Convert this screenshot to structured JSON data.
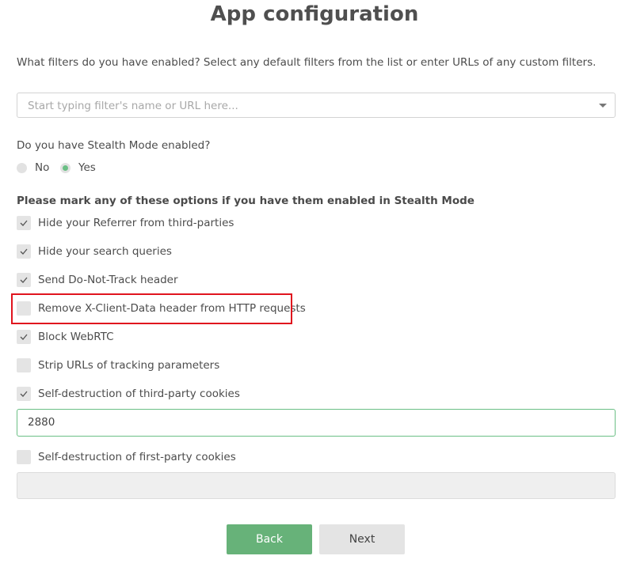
{
  "page": {
    "title": "App configuration",
    "intro": "What filters do you have enabled? Select any default filters from the list or enter URLs of any custom filters."
  },
  "filter_select": {
    "placeholder": "Start typing filter's name or URL here..."
  },
  "stealth": {
    "question": "Do you have Stealth Mode enabled?",
    "options": [
      {
        "label": "No",
        "selected": false
      },
      {
        "label": "Yes",
        "selected": true
      }
    ]
  },
  "stealth_options": {
    "heading": "Please mark any of these options if you have them enabled in Stealth Mode",
    "items": [
      {
        "label": "Hide your Referrer from third-parties",
        "checked": true
      },
      {
        "label": "Hide your search queries",
        "checked": true
      },
      {
        "label": "Send Do-Not-Track header",
        "checked": true
      },
      {
        "label": "Remove X-Client-Data header from HTTP requests",
        "checked": false
      },
      {
        "label": "Block WebRTC",
        "checked": true
      },
      {
        "label": "Strip URLs of tracking parameters",
        "checked": false
      },
      {
        "label": "Self-destruction of third-party cookies",
        "checked": true
      },
      {
        "label": "Self-destruction of first-party cookies",
        "checked": false
      }
    ],
    "third_party_cookie_value": "2880",
    "first_party_cookie_value": ""
  },
  "buttons": {
    "back": "Back",
    "next": "Next"
  },
  "colors": {
    "accent_green": "#67b279",
    "highlight_red": "#e0141e"
  }
}
